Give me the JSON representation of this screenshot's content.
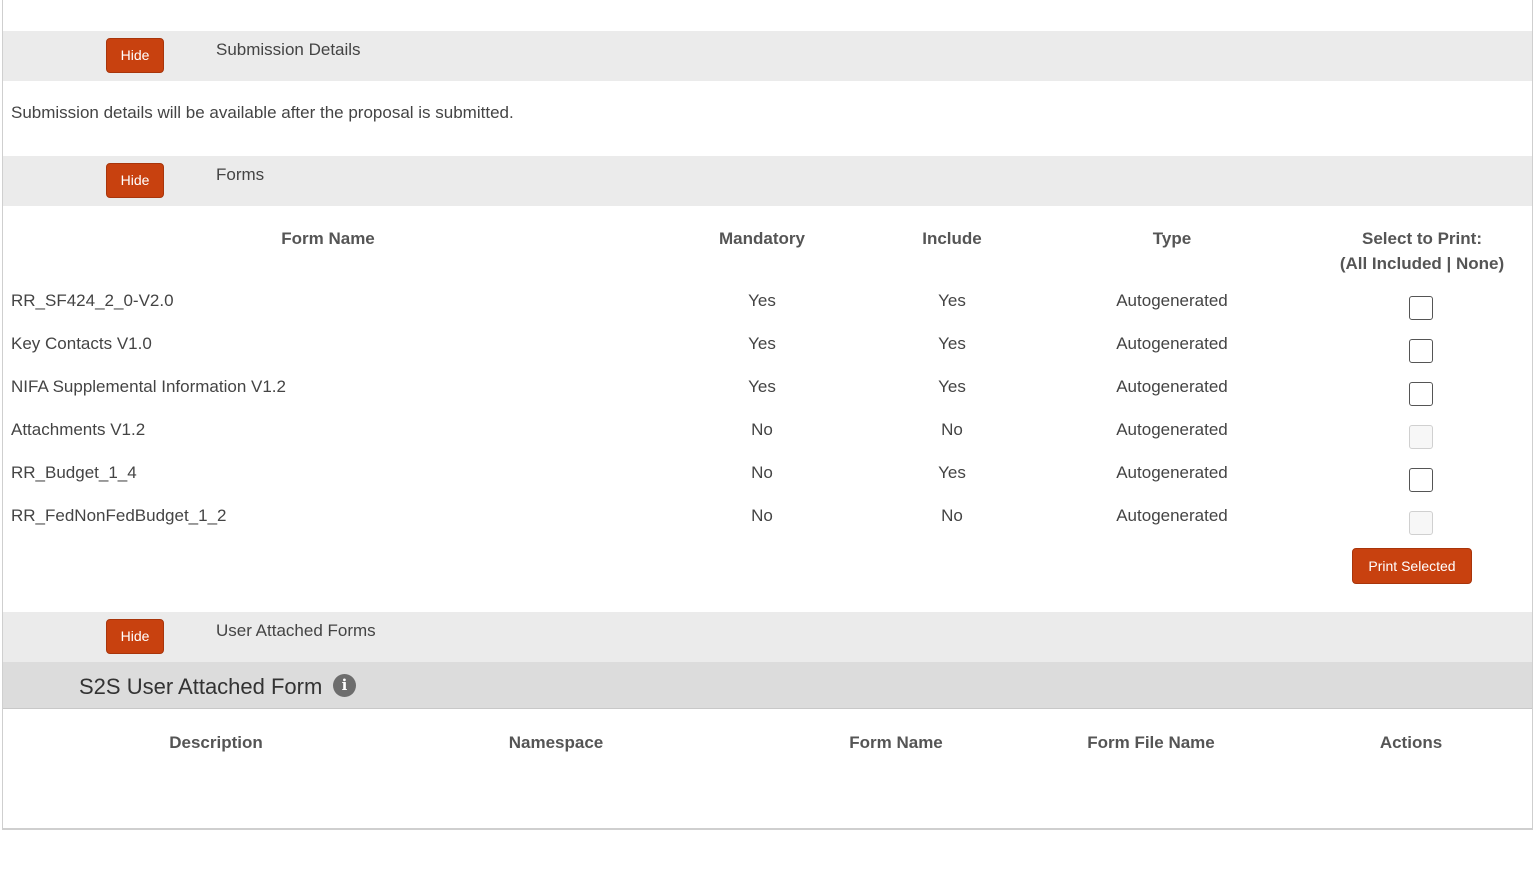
{
  "submission_section": {
    "hide_label": "Hide",
    "title": "Submission Details",
    "message": "Submission details will be available after the proposal is submitted."
  },
  "forms_section": {
    "hide_label": "Hide",
    "title": "Forms",
    "columns": {
      "form_name": "Form Name",
      "mandatory": "Mandatory",
      "include": "Include",
      "type": "Type",
      "select_to_print": "Select to Print:",
      "select_options": "(All Included | None)"
    },
    "rows": [
      {
        "form_name": "RR_SF424_2_0-V2.0",
        "mandatory": "Yes",
        "include": "Yes",
        "type": "Autogenerated",
        "printable": true
      },
      {
        "form_name": "Key Contacts V1.0",
        "mandatory": "Yes",
        "include": "Yes",
        "type": "Autogenerated",
        "printable": true
      },
      {
        "form_name": "NIFA Supplemental Information V1.2",
        "mandatory": "Yes",
        "include": "Yes",
        "type": "Autogenerated",
        "printable": true
      },
      {
        "form_name": "Attachments V1.2",
        "mandatory": "No",
        "include": "No",
        "type": "Autogenerated",
        "printable": false
      },
      {
        "form_name": "RR_Budget_1_4",
        "mandatory": "No",
        "include": "Yes",
        "type": "Autogenerated",
        "printable": true
      },
      {
        "form_name": "RR_FedNonFedBudget_1_2",
        "mandatory": "No",
        "include": "No",
        "type": "Autogenerated",
        "printable": false
      }
    ],
    "print_button_label": "Print Selected"
  },
  "user_attached_section": {
    "hide_label": "Hide",
    "title": "User Attached Forms",
    "subheader": "S2S User Attached Form",
    "info_icon_glyph": "i",
    "columns": {
      "description": "Description",
      "namespace": "Namespace",
      "form_name": "Form Name",
      "form_file_name": "Form File Name",
      "actions": "Actions"
    }
  },
  "colors": {
    "accent": "#c8410f",
    "section_bar": "#ebebeb",
    "subheader_bar": "#dcdcdc"
  }
}
